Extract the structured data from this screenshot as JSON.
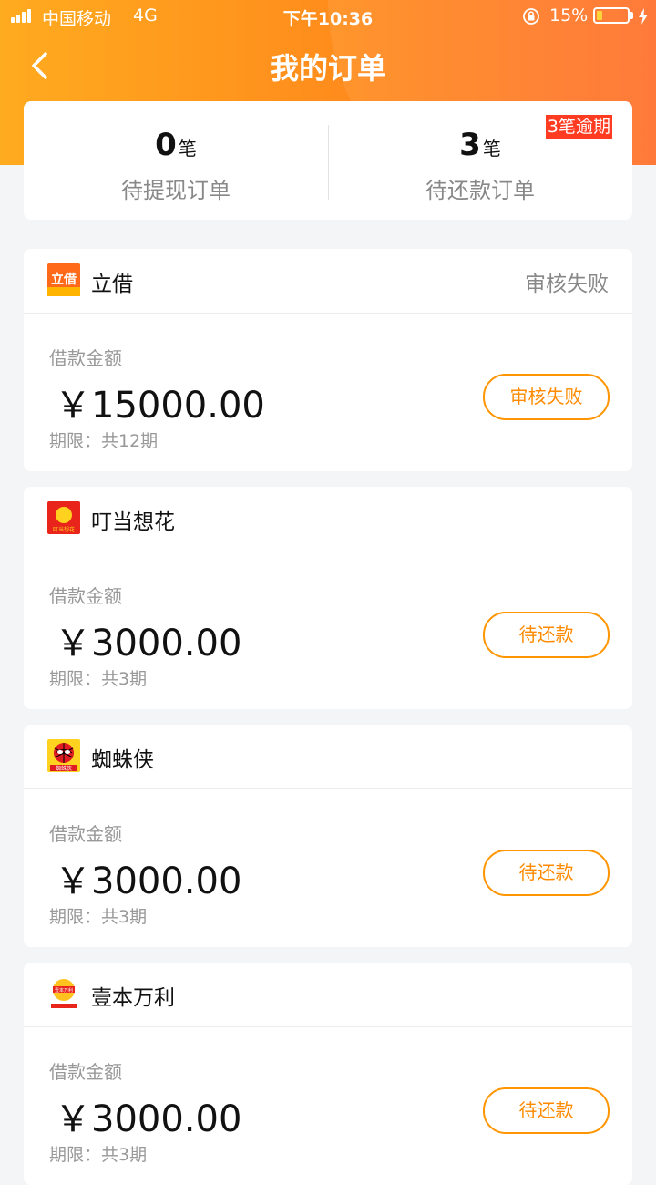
{
  "status_bar": {
    "carrier": "中国移动",
    "network": "4G",
    "time": "下午10:36",
    "battery_percent": "15%"
  },
  "header": {
    "title": "我的订单"
  },
  "summary": {
    "withdraw": {
      "count": "0",
      "unit": "笔",
      "label": "待提现订单"
    },
    "repay": {
      "count": "3",
      "unit": "笔",
      "label": "待还款订单"
    },
    "overdue_badge": "3笔逾期"
  },
  "orders": [
    {
      "lender": "立借",
      "logo_text": "立借",
      "status": "审核失败",
      "amount_label": "借款金额",
      "amount": "￥15000.00",
      "term": "期限：共12期",
      "action": "审核失败"
    },
    {
      "lender": "叮当想花",
      "logo_text": "叮当想花",
      "status": "",
      "amount_label": "借款金额",
      "amount": "￥3000.00",
      "term": "期限：共3期",
      "action": "待还款"
    },
    {
      "lender": "蜘蛛侠",
      "logo_text": "蜘蛛侠",
      "status": "",
      "amount_label": "借款金额",
      "amount": "￥3000.00",
      "term": "期限：共3期",
      "action": "待还款"
    },
    {
      "lender": "壹本万利",
      "logo_text": "壹本万利",
      "status": "",
      "amount_label": "借款金额",
      "amount": "￥3000.00",
      "term": "期限：共3期",
      "action": "待还款"
    }
  ],
  "colors": {
    "accent": "#ff8a00",
    "overdue": "#ff3b22",
    "header_start": "#ffab1f",
    "header_end": "#ff6f2a"
  },
  "icons": {
    "back": "chevron-left-icon",
    "signal": "signal-icon",
    "lock": "orientation-lock-icon",
    "battery": "battery-icon",
    "charging": "charging-bolt-icon"
  }
}
